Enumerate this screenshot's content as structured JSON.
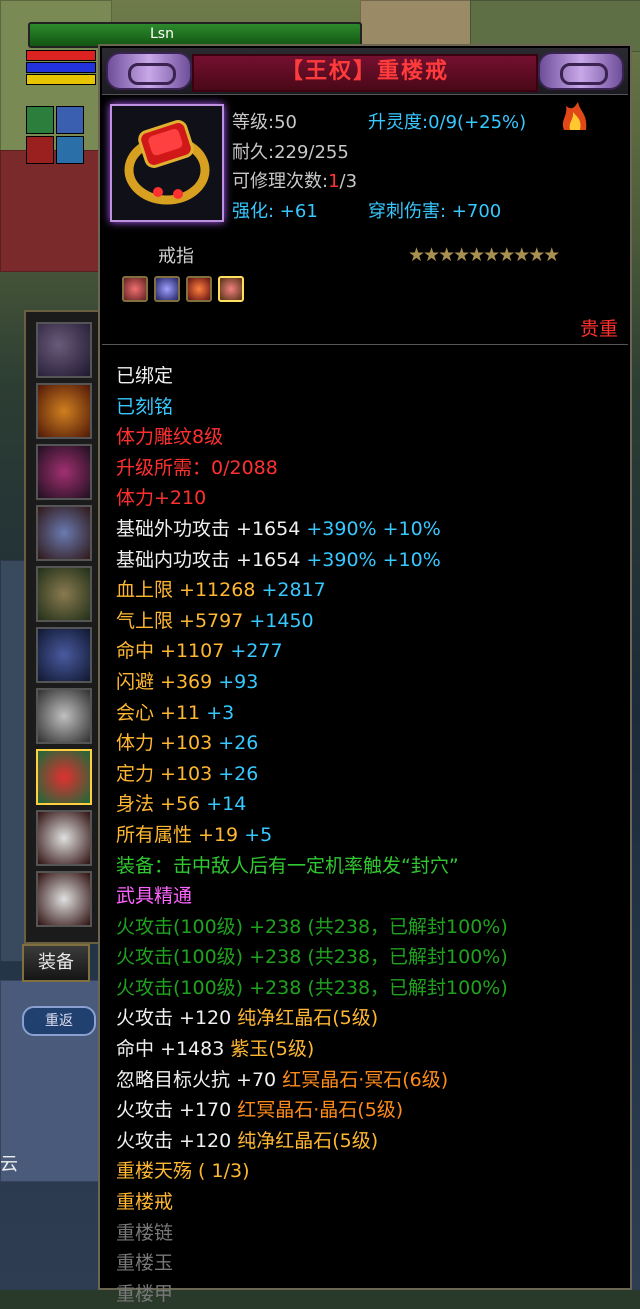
{
  "player": {
    "name": "Lsn"
  },
  "sidebar": {
    "equip_tab": "装备",
    "npc_button": "重返",
    "cloud_text": "云"
  },
  "tooltip": {
    "item_name": "【王权】重楼戒",
    "level": "等级:50",
    "ascend": "升灵度:0/9",
    "ascend_bonus": "(+25%)",
    "durability": "耐久:229/255",
    "repair_label": "可修理次数:",
    "repair_used": "1",
    "repair_total": "/3",
    "enhance": "强化: +61",
    "pierce": "穿刺伤害: +700",
    "type": "戒指",
    "stars": "★★★★★★★★★★",
    "rank": "贵重"
  },
  "colors": {
    "white": "#f0f0f0",
    "cyan": "#37c8ff",
    "red": "#ff3030",
    "gold": "#ffb732",
    "green": "#30c830",
    "pink": "#ff64ff",
    "dark_green": "#1fa31f",
    "orange": "#ff8c1a",
    "dim": "#777777"
  },
  "attributes": [
    [
      [
        "白",
        "已绑定"
      ]
    ],
    [
      [
        "cyan",
        "已刻铭"
      ]
    ],
    [
      [
        "red",
        "体力雕纹8级"
      ]
    ],
    [
      [
        "red",
        "升级所需：0/2088"
      ]
    ],
    [
      [
        "red",
        "体力+210"
      ]
    ],
    [
      [
        "white",
        "基础外功攻击 +1654 "
      ],
      [
        "cyan",
        "+390% +10%"
      ]
    ],
    [
      [
        "white",
        "基础内功攻击 +1654 "
      ],
      [
        "cyan",
        "+390% +10%"
      ]
    ],
    [
      [
        "gold",
        "血上限 +11268 "
      ],
      [
        "cyan",
        "+2817"
      ]
    ],
    [
      [
        "gold",
        "气上限 +5797 "
      ],
      [
        "cyan",
        "+1450"
      ]
    ],
    [
      [
        "gold",
        "命中 +1107 "
      ],
      [
        "cyan",
        "+277"
      ]
    ],
    [
      [
        "gold",
        "闪避 +369 "
      ],
      [
        "cyan",
        "+93"
      ]
    ],
    [
      [
        "gold",
        "会心 +11 "
      ],
      [
        "cyan",
        "+3"
      ]
    ],
    [
      [
        "gold",
        "体力 +103 "
      ],
      [
        "cyan",
        "+26"
      ]
    ],
    [
      [
        "gold",
        "定力 +103 "
      ],
      [
        "cyan",
        "+26"
      ]
    ],
    [
      [
        "gold",
        "身法 +56 "
      ],
      [
        "cyan",
        "+14"
      ]
    ],
    [
      [
        "gold",
        "所有属性 +19 "
      ],
      [
        "cyan",
        "+5"
      ]
    ],
    [
      [
        "green",
        "装备：击中敌人后有一定机率触发“封穴”"
      ]
    ],
    [
      [
        "pink",
        "武具精通"
      ]
    ],
    [
      [
        "dgreen",
        "火攻击(100级) +238 (共238，已解封100%)"
      ]
    ],
    [
      [
        "dgreen",
        "火攻击(100级) +238 (共238，已解封100%)"
      ]
    ],
    [
      [
        "dgreen",
        "火攻击(100级) +238 (共238，已解封100%)"
      ]
    ],
    [
      [
        "white",
        "火攻击 +120 "
      ],
      [
        "gold",
        "纯净红晶石(5级)"
      ]
    ],
    [
      [
        "white",
        "命中 +1483 "
      ],
      [
        "gold",
        "紫玉(5级)"
      ]
    ],
    [
      [
        "white",
        "忽略目标火抗 +70 "
      ],
      [
        "orange",
        "红冥晶石·冥石(6级)"
      ]
    ],
    [
      [
        "white",
        "火攻击 +170 "
      ],
      [
        "orange",
        "红冥晶石·晶石(5级)"
      ]
    ],
    [
      [
        "white",
        "火攻击 +120 "
      ],
      [
        "gold",
        "纯净红晶石(5级)"
      ]
    ],
    [
      [
        "gold",
        "重楼天殇 ( 1/3)"
      ]
    ],
    [
      [
        "gold",
        "重楼戒"
      ]
    ],
    [
      [
        "dim",
        "重楼链"
      ]
    ],
    [
      [
        "dim",
        "重楼玉"
      ]
    ],
    [
      [
        "dim",
        "重楼甲"
      ]
    ]
  ]
}
